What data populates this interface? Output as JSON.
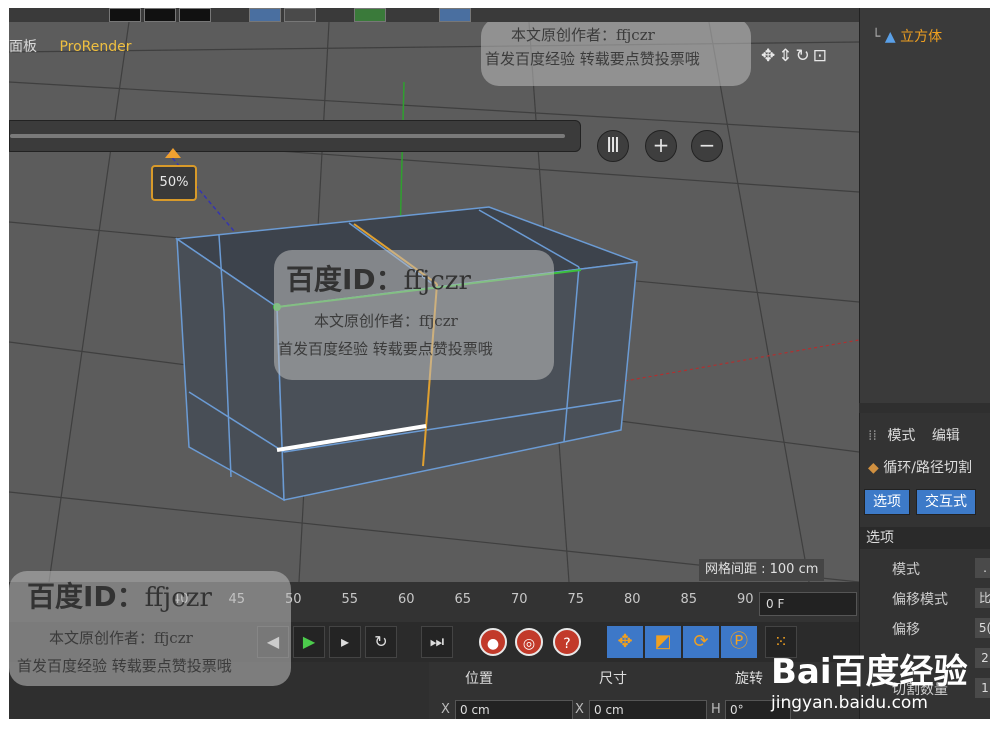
{
  "viewport": {
    "menu": [
      "面板",
      "ProRender"
    ],
    "slider_percent_label": "50%",
    "slider_value_fraction": 0.5,
    "round_buttons": [
      "Ⅲ",
      "+",
      "−"
    ],
    "grid_spacing_label": "网格间距 : 100 cm"
  },
  "watermark": {
    "id_line_bold": "百度ID：",
    "id_line_name": "ffjczr",
    "author_line": "本文原创作者：ffjczr",
    "promo_line": "首发百度经验 转载要点赞投票哦"
  },
  "timeline": {
    "ticks": [
      "40",
      "45",
      "50",
      "55",
      "60",
      "65",
      "70",
      "75",
      "80",
      "85",
      "90"
    ],
    "frame_field": "0 F"
  },
  "coordinates": {
    "headers": [
      "位置",
      "尺寸",
      "旋转"
    ],
    "axis_x": "X",
    "axis_h": "H",
    "position_x": "0 cm",
    "size_x": "0 cm",
    "rotation_h": "0°"
  },
  "object_manager": {
    "selected_object": "立方体"
  },
  "attributes": {
    "menu": [
      "模式",
      "编辑"
    ],
    "tool_name": "循环/路径切割",
    "tabs": [
      "选项",
      "交互式"
    ],
    "section": "选项",
    "props": [
      {
        "label": "模式",
        "value": "."
      },
      {
        "label": "偏移模式",
        "value": "比"
      },
      {
        "label": "偏移",
        "value": "5("
      },
      {
        "label": "",
        "value": "2"
      },
      {
        "label": "切割数量",
        "value": "1"
      }
    ]
  },
  "branding": {
    "logo": "Bai百度经验",
    "url": "jingyan.baidu.com"
  },
  "colors": {
    "accent_orange": "#f0a020",
    "selection_blue": "#3d7ac8",
    "cut_line": "#e0a030",
    "edge_green": "#3cc03c"
  }
}
